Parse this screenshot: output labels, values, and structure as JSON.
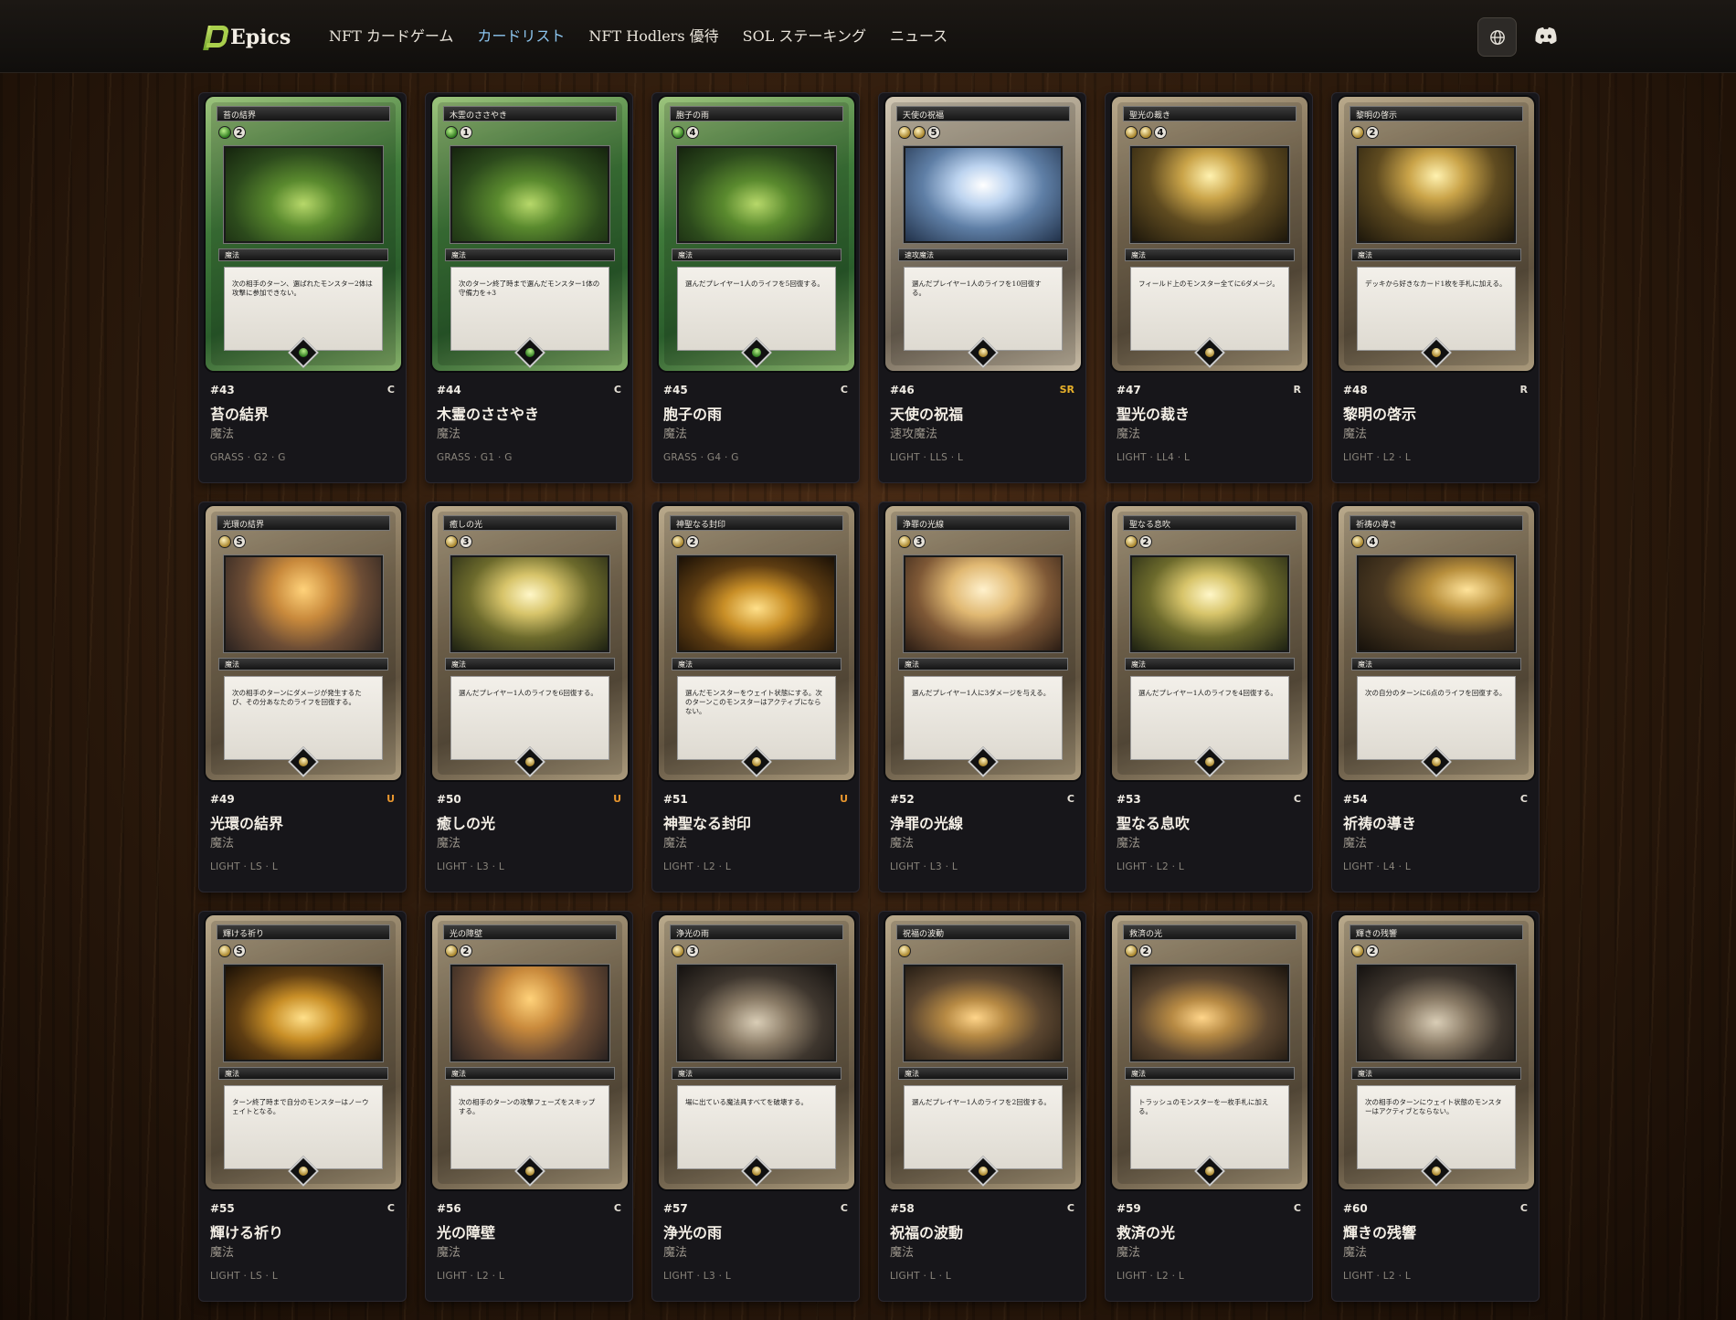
{
  "header": {
    "logo_text": "Epics",
    "nav": [
      {
        "label": "NFT カードゲーム",
        "active": false
      },
      {
        "label": "カードリスト",
        "active": true
      },
      {
        "label": "NFT Hodlers 優待",
        "active": false
      },
      {
        "label": "SOL ステーキング",
        "active": false
      },
      {
        "label": "ニュース",
        "active": false
      }
    ],
    "icons": {
      "language": "globe-icon",
      "discord": "discord-icon"
    }
  },
  "cards": [
    {
      "id": "#43",
      "rarity": "C",
      "name": "苔の結界",
      "type": "魔法",
      "meta": "GRASS · G2 · G",
      "element": "grass",
      "cost": [
        "g"
      ],
      "cost_num": "2",
      "art": "art-grass",
      "text": "次の相手のターン、選ばれたモンスター2体は攻撃に参加できない。"
    },
    {
      "id": "#44",
      "rarity": "C",
      "name": "木霊のささやき",
      "type": "魔法",
      "meta": "GRASS · G1 · G",
      "element": "grass",
      "cost": [
        "g"
      ],
      "cost_num": "1",
      "art": "art-grass",
      "text": "次のターン終了時まで選んだモンスター1体の守備力を+3"
    },
    {
      "id": "#45",
      "rarity": "C",
      "name": "胞子の雨",
      "type": "魔法",
      "meta": "GRASS · G4 · G",
      "element": "grass",
      "cost": [
        "g"
      ],
      "cost_num": "4",
      "art": "art-grass",
      "text": "選んだプレイヤー1人のライフを5回復する。"
    },
    {
      "id": "#46",
      "rarity": "SR",
      "name": "天使の祝福",
      "type": "速攻魔法",
      "meta": "LIGHT · LLS · L",
      "element": "sr",
      "cost": [
        "l",
        "l"
      ],
      "cost_num": "5",
      "art": "art-sr",
      "text": "選んだプレイヤー1人のライフを10回復する。"
    },
    {
      "id": "#47",
      "rarity": "R",
      "name": "聖光の裁き",
      "type": "魔法",
      "meta": "LIGHT · LL4 · L",
      "element": "light",
      "cost": [
        "l",
        "l"
      ],
      "cost_num": "4",
      "art": "art-beam",
      "text": "フィールド上のモンスター全てに6ダメージ。"
    },
    {
      "id": "#48",
      "rarity": "R",
      "name": "黎明の啓示",
      "type": "魔法",
      "meta": "LIGHT · L2 · L",
      "element": "light",
      "cost": [
        "l"
      ],
      "cost_num": "2",
      "art": "art-beam",
      "text": "デッキから好きなカード1枚を手札に加える。"
    },
    {
      "id": "#49",
      "rarity": "U",
      "name": "光環の結界",
      "type": "魔法",
      "meta": "LIGHT · LS · L",
      "element": "light",
      "cost": [
        "l"
      ],
      "cost_num": "S",
      "art": "art-ring",
      "text": "次の相手のターンにダメージが発生するたび、その分あなたのライフを回復する。"
    },
    {
      "id": "#50",
      "rarity": "U",
      "name": "癒しの光",
      "type": "魔法",
      "meta": "LIGHT · L3 · L",
      "element": "light",
      "cost": [
        "l"
      ],
      "cost_num": "3",
      "art": "art-forest",
      "text": "選んだプレイヤー1人のライフを6回復する。"
    },
    {
      "id": "#51",
      "rarity": "U",
      "name": "神聖なる封印",
      "type": "魔法",
      "meta": "LIGHT · L2 · L",
      "element": "light",
      "cost": [
        "l"
      ],
      "cost_num": "2",
      "art": "art-gold",
      "text": "選んだモンスターをウェイト状態にする。次のターンこのモンスターはアクティブにならない。"
    },
    {
      "id": "#52",
      "rarity": "C",
      "name": "浄罪の光線",
      "type": "魔法",
      "meta": "LIGHT · L3 · L",
      "element": "light",
      "cost": [
        "l"
      ],
      "cost_num": "3",
      "art": "art-angel",
      "text": "選んだプレイヤー1人に3ダメージを与える。"
    },
    {
      "id": "#53",
      "rarity": "C",
      "name": "聖なる息吹",
      "type": "魔法",
      "meta": "LIGHT · L2 · L",
      "element": "light",
      "cost": [
        "l"
      ],
      "cost_num": "2",
      "art": "art-forest",
      "text": "選んだプレイヤー1人のライフを4回復する。"
    },
    {
      "id": "#54",
      "rarity": "C",
      "name": "祈祷の導き",
      "type": "魔法",
      "meta": "LIGHT · L4 · L",
      "element": "light",
      "cost": [
        "l"
      ],
      "cost_num": "4",
      "art": "art-cave",
      "text": "次の自分のターンに6点のライフを回復する。"
    },
    {
      "id": "#55",
      "rarity": "C",
      "name": "輝ける祈り",
      "type": "魔法",
      "meta": "LIGHT · LS · L",
      "element": "light",
      "cost": [
        "l"
      ],
      "cost_num": "S",
      "art": "art-gold",
      "text": "ターン終了時まで自分のモンスターはノーウェイトとなる。"
    },
    {
      "id": "#56",
      "rarity": "C",
      "name": "光の障壁",
      "type": "魔法",
      "meta": "LIGHT · L2 · L",
      "element": "light",
      "cost": [
        "l"
      ],
      "cost_num": "2",
      "art": "art-ring",
      "text": "次の相手のターンの攻撃フェーズをスキップする。"
    },
    {
      "id": "#57",
      "rarity": "C",
      "name": "浄光の雨",
      "type": "魔法",
      "meta": "LIGHT · L3 · L",
      "element": "light",
      "cost": [
        "l"
      ],
      "cost_num": "3",
      "art": "art-stone",
      "text": "場に出ている魔法具すべてを破壊する。"
    },
    {
      "id": "#58",
      "rarity": "C",
      "name": "祝福の波動",
      "type": "魔法",
      "meta": "LIGHT · L · L",
      "element": "light",
      "cost": [
        "l"
      ],
      "cost_num": "",
      "art": "art-dusk",
      "text": "選んだプレイヤー1人のライフを2回復する。"
    },
    {
      "id": "#59",
      "rarity": "C",
      "name": "救済の光",
      "type": "魔法",
      "meta": "LIGHT · L2 · L",
      "element": "light",
      "cost": [
        "l"
      ],
      "cost_num": "2",
      "art": "art-dusk",
      "text": "トラッシュのモンスターを一枚手札に加える。"
    },
    {
      "id": "#60",
      "rarity": "C",
      "name": "輝きの残響",
      "type": "魔法",
      "meta": "LIGHT · L2 · L",
      "element": "light",
      "cost": [
        "l"
      ],
      "cost_num": "2",
      "art": "art-stone",
      "text": "次の相手のターンにウェイト状態のモンスターはアクティブとならない。"
    }
  ]
}
